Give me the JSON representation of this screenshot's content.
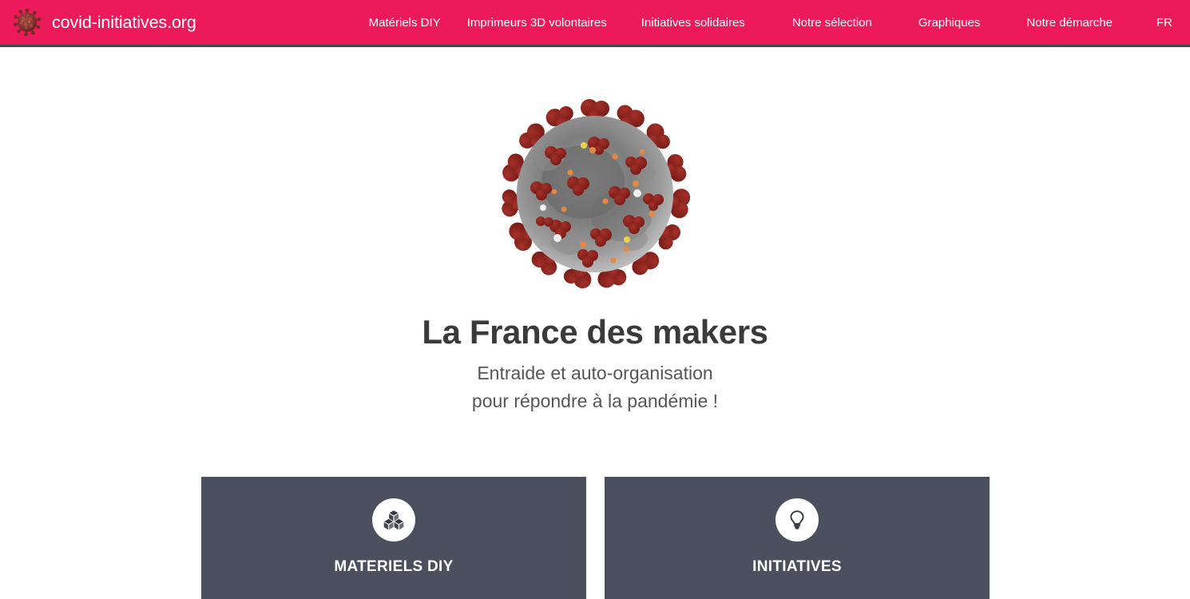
{
  "header": {
    "logo_icon": "coronavirus-icon",
    "brand_title": "covid-initiatives.org",
    "background_color": "#ec1a5b",
    "border_color": "#41464f",
    "nav_items": [
      {
        "label": "Matériels DIY"
      },
      {
        "label": "Imprimeurs 3D volontaires"
      },
      {
        "label": "Initiatives solidaires"
      },
      {
        "label": "Notre sélection"
      },
      {
        "label": "Graphiques"
      },
      {
        "label": "Notre démarche"
      },
      {
        "label": "FR"
      }
    ]
  },
  "hero": {
    "image_icon": "sars-cov-2-virus-illustration",
    "title": "La France des makers",
    "subtitle_line1": "Entraide et auto-organisation",
    "subtitle_line2": "pour répondre à la pandémie !",
    "title_color": "#3a3a3c",
    "subtitle_color": "#55565a"
  },
  "cards": {
    "background_color": "#4c505e",
    "items": [
      {
        "icon": "boxes-icon",
        "label": "MATERIELS DIY"
      },
      {
        "icon": "lightbulb-icon",
        "label": "INITIATIVES"
      }
    ]
  }
}
